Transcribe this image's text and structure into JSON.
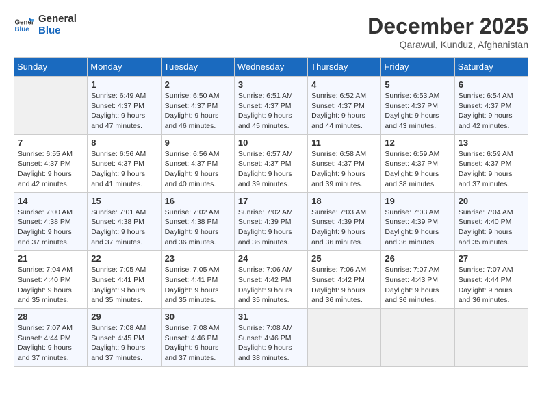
{
  "header": {
    "logo_line1": "General",
    "logo_line2": "Blue",
    "title": "December 2025",
    "subtitle": "Qarawul, Kunduz, Afghanistan"
  },
  "weekdays": [
    "Sunday",
    "Monday",
    "Tuesday",
    "Wednesday",
    "Thursday",
    "Friday",
    "Saturday"
  ],
  "weeks": [
    [
      {
        "day": "",
        "empty": true
      },
      {
        "day": "1",
        "sunrise": "6:49 AM",
        "sunset": "4:37 PM",
        "daylight": "9 hours and 47 minutes."
      },
      {
        "day": "2",
        "sunrise": "6:50 AM",
        "sunset": "4:37 PM",
        "daylight": "9 hours and 46 minutes."
      },
      {
        "day": "3",
        "sunrise": "6:51 AM",
        "sunset": "4:37 PM",
        "daylight": "9 hours and 45 minutes."
      },
      {
        "day": "4",
        "sunrise": "6:52 AM",
        "sunset": "4:37 PM",
        "daylight": "9 hours and 44 minutes."
      },
      {
        "day": "5",
        "sunrise": "6:53 AM",
        "sunset": "4:37 PM",
        "daylight": "9 hours and 43 minutes."
      },
      {
        "day": "6",
        "sunrise": "6:54 AM",
        "sunset": "4:37 PM",
        "daylight": "9 hours and 42 minutes."
      }
    ],
    [
      {
        "day": "7",
        "sunrise": "6:55 AM",
        "sunset": "4:37 PM",
        "daylight": "9 hours and 42 minutes."
      },
      {
        "day": "8",
        "sunrise": "6:56 AM",
        "sunset": "4:37 PM",
        "daylight": "9 hours and 41 minutes."
      },
      {
        "day": "9",
        "sunrise": "6:56 AM",
        "sunset": "4:37 PM",
        "daylight": "9 hours and 40 minutes."
      },
      {
        "day": "10",
        "sunrise": "6:57 AM",
        "sunset": "4:37 PM",
        "daylight": "9 hours and 39 minutes."
      },
      {
        "day": "11",
        "sunrise": "6:58 AM",
        "sunset": "4:37 PM",
        "daylight": "9 hours and 39 minutes."
      },
      {
        "day": "12",
        "sunrise": "6:59 AM",
        "sunset": "4:37 PM",
        "daylight": "9 hours and 38 minutes."
      },
      {
        "day": "13",
        "sunrise": "6:59 AM",
        "sunset": "4:37 PM",
        "daylight": "9 hours and 37 minutes."
      }
    ],
    [
      {
        "day": "14",
        "sunrise": "7:00 AM",
        "sunset": "4:38 PM",
        "daylight": "9 hours and 37 minutes."
      },
      {
        "day": "15",
        "sunrise": "7:01 AM",
        "sunset": "4:38 PM",
        "daylight": "9 hours and 37 minutes."
      },
      {
        "day": "16",
        "sunrise": "7:02 AM",
        "sunset": "4:38 PM",
        "daylight": "9 hours and 36 minutes."
      },
      {
        "day": "17",
        "sunrise": "7:02 AM",
        "sunset": "4:39 PM",
        "daylight": "9 hours and 36 minutes."
      },
      {
        "day": "18",
        "sunrise": "7:03 AM",
        "sunset": "4:39 PM",
        "daylight": "9 hours and 36 minutes."
      },
      {
        "day": "19",
        "sunrise": "7:03 AM",
        "sunset": "4:39 PM",
        "daylight": "9 hours and 36 minutes."
      },
      {
        "day": "20",
        "sunrise": "7:04 AM",
        "sunset": "4:40 PM",
        "daylight": "9 hours and 35 minutes."
      }
    ],
    [
      {
        "day": "21",
        "sunrise": "7:04 AM",
        "sunset": "4:40 PM",
        "daylight": "9 hours and 35 minutes."
      },
      {
        "day": "22",
        "sunrise": "7:05 AM",
        "sunset": "4:41 PM",
        "daylight": "9 hours and 35 minutes."
      },
      {
        "day": "23",
        "sunrise": "7:05 AM",
        "sunset": "4:41 PM",
        "daylight": "9 hours and 35 minutes."
      },
      {
        "day": "24",
        "sunrise": "7:06 AM",
        "sunset": "4:42 PM",
        "daylight": "9 hours and 35 minutes."
      },
      {
        "day": "25",
        "sunrise": "7:06 AM",
        "sunset": "4:42 PM",
        "daylight": "9 hours and 36 minutes."
      },
      {
        "day": "26",
        "sunrise": "7:07 AM",
        "sunset": "4:43 PM",
        "daylight": "9 hours and 36 minutes."
      },
      {
        "day": "27",
        "sunrise": "7:07 AM",
        "sunset": "4:44 PM",
        "daylight": "9 hours and 36 minutes."
      }
    ],
    [
      {
        "day": "28",
        "sunrise": "7:07 AM",
        "sunset": "4:44 PM",
        "daylight": "9 hours and 37 minutes."
      },
      {
        "day": "29",
        "sunrise": "7:08 AM",
        "sunset": "4:45 PM",
        "daylight": "9 hours and 37 minutes."
      },
      {
        "day": "30",
        "sunrise": "7:08 AM",
        "sunset": "4:46 PM",
        "daylight": "9 hours and 37 minutes."
      },
      {
        "day": "31",
        "sunrise": "7:08 AM",
        "sunset": "4:46 PM",
        "daylight": "9 hours and 38 minutes."
      },
      {
        "day": "",
        "empty": true
      },
      {
        "day": "",
        "empty": true
      },
      {
        "day": "",
        "empty": true
      }
    ]
  ],
  "labels": {
    "sunrise_prefix": "Sunrise: ",
    "sunset_prefix": "Sunset: ",
    "daylight_prefix": "Daylight: "
  }
}
